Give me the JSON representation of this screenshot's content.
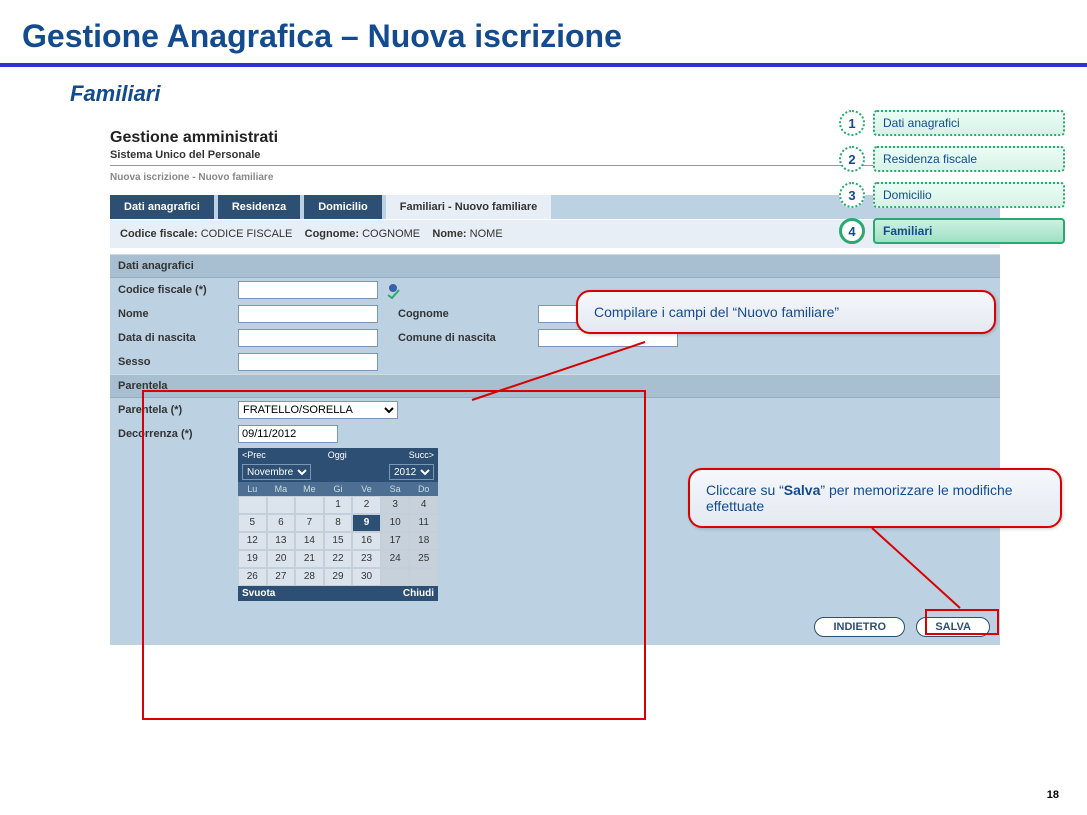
{
  "page": {
    "title": "Gestione Anagrafica – Nuova iscrizione",
    "subtitle": "Familiari",
    "number": "18"
  },
  "steps": [
    {
      "num": "1",
      "label": "Dati anagrafici"
    },
    {
      "num": "2",
      "label": "Residenza fiscale"
    },
    {
      "num": "3",
      "label": "Domicilio"
    },
    {
      "num": "4",
      "label": "Familiari"
    }
  ],
  "app": {
    "title": "Gestione amministrati",
    "subtitle": "Sistema Unico del Personale",
    "breadcrumb": "Nuova iscrizione - Nuovo familiare",
    "tabs": [
      {
        "label": "Dati anagrafici"
      },
      {
        "label": "Residenza"
      },
      {
        "label": "Domicilio"
      },
      {
        "label": "Familiari - Nuovo familiare"
      }
    ],
    "idbar": {
      "cf_label": "Codice fiscale:",
      "cf_value": "CODICE FISCALE",
      "cognome_label": "Cognome:",
      "cognome_value": "COGNOME",
      "nome_label": "Nome:",
      "nome_value": "NOME"
    },
    "form": {
      "sec1": "Dati anagrafici",
      "cf": "Codice fiscale (*)",
      "nome": "Nome",
      "cognome": "Cognome",
      "dnascita": "Data di nascita",
      "cnascita": "Comune di nascita",
      "sesso": "Sesso",
      "sec2": "Parentela",
      "parentela": "Parentela (*)",
      "parentela_value": "FRATELLO/SORELLA",
      "decorrenza": "Decorrenza (*)",
      "decorrenza_value": "09/11/2012"
    },
    "datepicker": {
      "prec": "<Prec",
      "oggi": "Oggi",
      "succ": "Succ>",
      "month": "Novembre",
      "year": "2012",
      "dow": [
        "Lu",
        "Ma",
        "Me",
        "Gi",
        "Ve",
        "Sa",
        "Do"
      ],
      "grid": [
        [
          "",
          "",
          "",
          "1",
          "2",
          "3",
          "4"
        ],
        [
          "5",
          "6",
          "7",
          "8",
          "9",
          "10",
          "11"
        ],
        [
          "12",
          "13",
          "14",
          "15",
          "16",
          "17",
          "18"
        ],
        [
          "19",
          "20",
          "21",
          "22",
          "23",
          "24",
          "25"
        ],
        [
          "26",
          "27",
          "28",
          "29",
          "30",
          "",
          ""
        ]
      ],
      "selected": "9",
      "svuota": "Svuota",
      "chiudi": "Chiudi"
    },
    "actions": {
      "indietro": "INDIETRO",
      "salva": "SALVA"
    }
  },
  "callouts": {
    "c1": "Compilare i campi del “Nuovo familiare”",
    "c2_pre": "Cliccare su “",
    "c2_bold": "Salva",
    "c2_post": "” per memorizzare le modifiche effettuate"
  }
}
